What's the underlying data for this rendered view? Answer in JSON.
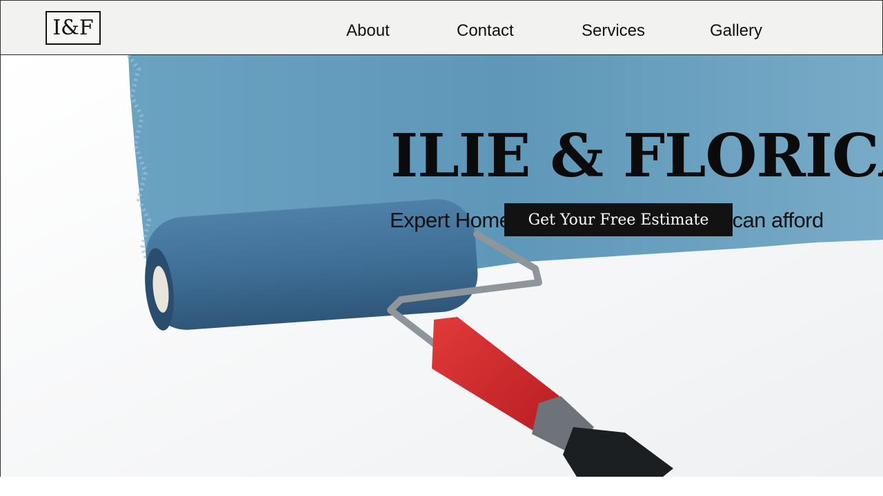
{
  "header": {
    "logo_text": "I&F",
    "nav": [
      "About",
      "Contact",
      "Services",
      "Gallery"
    ]
  },
  "hero": {
    "title": "ILIE & FLORICA",
    "subtitle": "Expert Home Improvements that you can afford",
    "cta_label": "Get Your Free Estimate",
    "image_subject": "paint-roller-on-wall"
  },
  "colors": {
    "header_bg": "#f2f2f0",
    "paint_blue": "#5e97b8",
    "roller_blue": "#3f6f97",
    "handle_red": "#d8262b",
    "cta_bg": "#121212"
  }
}
